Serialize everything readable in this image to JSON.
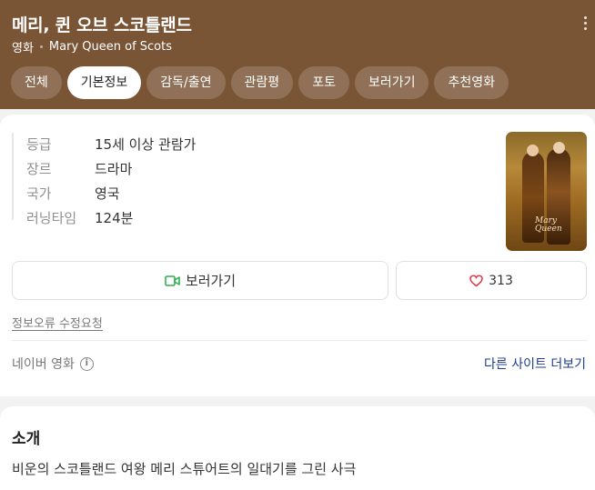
{
  "header": {
    "title": "메리, 퀸 오브 스코틀랜드",
    "category": "영화",
    "original_title": "Mary Queen of Scots"
  },
  "tabs": [
    {
      "label": "전체",
      "active": false
    },
    {
      "label": "기본정보",
      "active": true
    },
    {
      "label": "감독/출연",
      "active": false
    },
    {
      "label": "관람평",
      "active": false
    },
    {
      "label": "포토",
      "active": false
    },
    {
      "label": "보러가기",
      "active": false
    },
    {
      "label": "추천영화",
      "active": false
    }
  ],
  "info": [
    {
      "key": "등급",
      "value": "15세 이상 관람가"
    },
    {
      "key": "장르",
      "value": "드라마"
    },
    {
      "key": "국가",
      "value": "영국"
    },
    {
      "key": "러닝타임",
      "value": "124분"
    }
  ],
  "actions": {
    "watch_label": "보러가기",
    "like_count": "313"
  },
  "links": {
    "report_error": "정보오류 수정요청",
    "source": "네이버 영화",
    "other_sites": "다른 사이트 더보기"
  },
  "intro": {
    "title": "소개",
    "text": "비운의 스코틀랜드 여왕 메리 스튜어트의 일대기를 그린 사극"
  },
  "colors": {
    "header_bg": "#7a5535",
    "watch_icon": "#2bb24c",
    "heart_icon": "#e8333f",
    "link_blue": "#1a3d8f"
  },
  "icons": {
    "watch": "video-camera-icon",
    "like": "heart-icon",
    "info": "info-circle-icon",
    "more": "more-vertical-icon"
  }
}
